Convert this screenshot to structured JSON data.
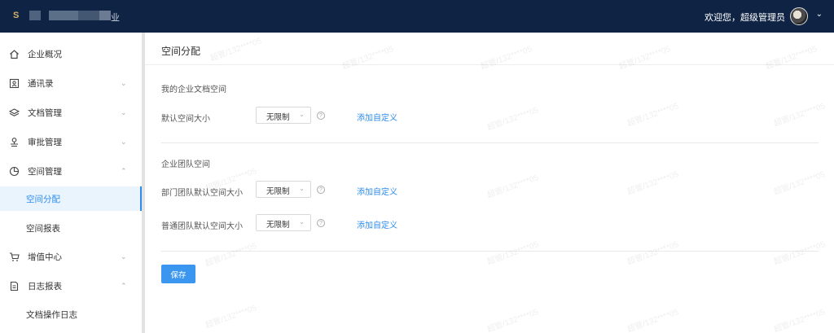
{
  "header": {
    "brand_suffix": "业",
    "welcome": "欢迎您，超级管理员"
  },
  "sidebar": {
    "items": [
      {
        "label": "企业概况",
        "icon": "home-icon"
      },
      {
        "label": "通讯录",
        "icon": "contacts-icon"
      },
      {
        "label": "文档管理",
        "icon": "layers-icon"
      },
      {
        "label": "审批管理",
        "icon": "stamp-icon"
      },
      {
        "label": "空间管理",
        "icon": "pie-chart-icon"
      },
      {
        "label": "空间分配"
      },
      {
        "label": "空间报表"
      },
      {
        "label": "增值中心",
        "icon": "cart-icon"
      },
      {
        "label": "日志报表",
        "icon": "document-icon"
      },
      {
        "label": "文档操作日志"
      }
    ]
  },
  "main": {
    "title": "空间分配",
    "enterprise_section": {
      "heading": "我的企业文档空间",
      "rows": [
        {
          "label": "默认空间大小",
          "value": "无限制",
          "link": "添加自定义"
        }
      ]
    },
    "team_section": {
      "heading": "企业团队空间",
      "rows": [
        {
          "label": "部门团队默认空间大小",
          "value": "无限制",
          "link": "添加自定义"
        },
        {
          "label": "普通团队默认空间大小",
          "value": "无限制",
          "link": "添加自定义"
        }
      ]
    },
    "save_label": "保存",
    "watermark": "超管/132****05"
  },
  "colors": {
    "header_bg": "#0f2444",
    "accent": "#2d8ceb",
    "button": "#3a96ef"
  }
}
